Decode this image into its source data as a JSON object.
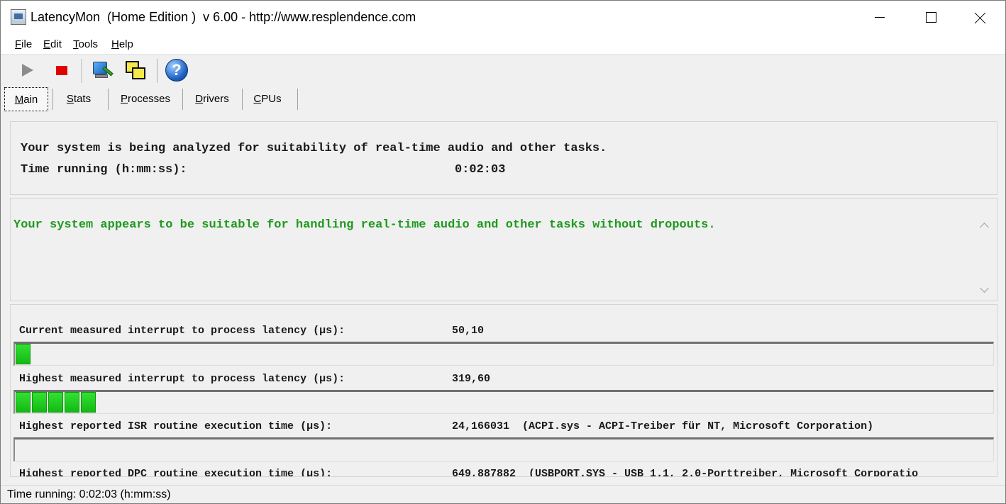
{
  "window": {
    "title": "LatencyMon  (Home Edition )  v 6.00 - http://www.resplendence.com"
  },
  "menu": {
    "items": [
      {
        "first": "F",
        "rest": "ile"
      },
      {
        "first": "E",
        "rest": "dit"
      },
      {
        "first": "T",
        "rest": "ools"
      },
      {
        "first": "H",
        "rest": "elp"
      }
    ]
  },
  "toolbar": {
    "icons": [
      "play-icon",
      "stop-icon",
      "monitor-icon",
      "windows-icon",
      "help-icon"
    ],
    "help_glyph": "?"
  },
  "tabs": [
    {
      "first": "M",
      "rest": "ain",
      "active": true
    },
    {
      "first": "S",
      "rest": "tats",
      "active": false
    },
    {
      "first": "P",
      "rest": "rocesses",
      "active": false
    },
    {
      "first": "D",
      "rest": "rivers",
      "active": false
    },
    {
      "first": "C",
      "rest": "PUs",
      "active": false
    }
  ],
  "main": {
    "analysis_text": "Your system is being analyzed for suitability of real-time audio and other tasks.",
    "time_label": "Time running (h:mm:ss):",
    "time_value": "0:02:03",
    "verdict": "Your system appears to be suitable for handling real-time audio and other tasks without dropouts.",
    "metrics": [
      {
        "label": "Current measured interrupt to process latency (µs):",
        "value": "50,10",
        "detail": "",
        "fill_segments": 1
      },
      {
        "label": "Highest measured interrupt to process latency (µs):",
        "value": "319,60",
        "detail": "",
        "fill_segments": 5
      },
      {
        "label": "Highest reported ISR routine execution time (µs):",
        "value": "24,166031",
        "detail": "(ACPI.sys - ACPI-Treiber für NT, Microsoft Corporation)",
        "fill_segments": 0
      },
      {
        "label": "Highest reported DPC routine execution time (µs):",
        "value": "649,887882",
        "detail": "(USBPORT.SYS - USB 1.1, 2.0-Porttreiber, Microsoft Corporatio",
        "fill_segments": 0
      }
    ]
  },
  "statusbar": {
    "text": "Time running: 0:02:03  (h:mm:ss)"
  },
  "colors": {
    "verdict_green": "#1f9a1f",
    "bar_green": "#14b914",
    "stop_red": "#e00000"
  }
}
